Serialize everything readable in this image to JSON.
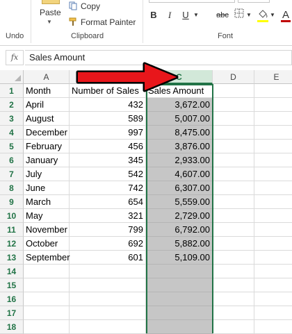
{
  "ribbon": {
    "clipboard": {
      "paste_label": "Paste",
      "copy_label": "Copy",
      "format_painter_label": "Format Painter",
      "group_label": "Clipboard"
    },
    "undo_group_label": "Undo",
    "font": {
      "group_label": "Font",
      "bold": "B",
      "italic": "I",
      "underline": "U",
      "strikethrough": "abc",
      "fill_color_hex": "#ffff00",
      "font_color_hex": "#c00000"
    }
  },
  "formula_bar": {
    "fx_label": "fx",
    "value": "Sales Amount"
  },
  "grid": {
    "columns": [
      "A",
      "B",
      "C",
      "D",
      "E"
    ],
    "selected_column": "C",
    "row_numbers": [
      "1",
      "2",
      "3",
      "4",
      "5",
      "6",
      "7",
      "8",
      "9",
      "10",
      "11",
      "12",
      "13",
      "14",
      "15",
      "16",
      "17",
      "18"
    ],
    "header_row": [
      "Month",
      "Number of Sales",
      "Sales Amount"
    ],
    "rows": [
      [
        "April",
        "432",
        "3,672.00"
      ],
      [
        "August",
        "589",
        "5,007.00"
      ],
      [
        "December",
        "997",
        "8,475.00"
      ],
      [
        "February",
        "456",
        "3,876.00"
      ],
      [
        "January",
        "345",
        "2,933.00"
      ],
      [
        "July",
        "542",
        "4,607.00"
      ],
      [
        "June",
        "742",
        "6,307.00"
      ],
      [
        "March",
        "654",
        "5,559.00"
      ],
      [
        "May",
        "321",
        "2,729.00"
      ],
      [
        "November",
        "799",
        "6,792.00"
      ],
      [
        "October",
        "692",
        "5,882.00"
      ],
      [
        "September",
        "601",
        "5,109.00"
      ]
    ]
  },
  "annotation": {
    "arrow_color": "#e8161b",
    "arrow_target": "column C header"
  }
}
